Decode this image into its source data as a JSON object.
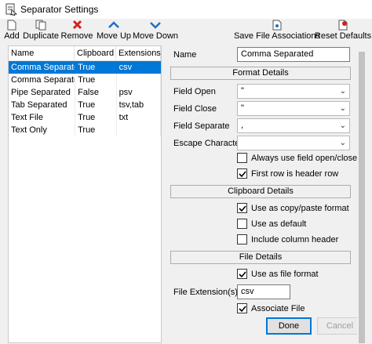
{
  "window": {
    "title": "Separator Settings"
  },
  "toolbar": {
    "add": "Add",
    "duplicate": "Duplicate",
    "remove": "Remove",
    "move_up": "Move Up",
    "move_down": "Move Down",
    "save_assoc": "Save File Associations",
    "reset": "Reset Defaults"
  },
  "list": {
    "headers": {
      "name": "Name",
      "clipboard": "Clipboard",
      "extensions": "Extensions"
    },
    "rows": [
      {
        "name": "Comma Separated",
        "clipboard": "True",
        "extensions": "csv"
      },
      {
        "name": "Comma Separated",
        "clipboard": "True",
        "extensions": ""
      },
      {
        "name": "Pipe Separated",
        "clipboard": "False",
        "extensions": "psv"
      },
      {
        "name": "Tab Separated",
        "clipboard": "True",
        "extensions": "tsv,tab"
      },
      {
        "name": "Text File",
        "clipboard": "True",
        "extensions": "txt"
      },
      {
        "name": "Text Only",
        "clipboard": "True",
        "extensions": ""
      }
    ]
  },
  "form": {
    "name_label": "Name",
    "name_value": "Comma Separated",
    "format_section": "Format Details",
    "field_open_label": "Field Open",
    "field_open_value": "\"",
    "field_close_label": "Field Close",
    "field_close_value": "\"",
    "field_sep_label": "Field Separate",
    "field_sep_value": ",",
    "escape_label": "Escape Character",
    "escape_value": "",
    "always_open_close": "Always use field open/close",
    "first_row_header": "First row is header row",
    "clipboard_section": "Clipboard Details",
    "use_copy_paste": "Use as copy/paste format",
    "use_default": "Use as default",
    "include_header": "Include column header",
    "file_section": "File Details",
    "use_file_format": "Use as file format",
    "file_ext_label": "File Extension(s)",
    "file_ext_value": "csv",
    "associate_file": "Associate File",
    "done": "Done",
    "cancel": "Cancel"
  },
  "checks": {
    "always_open_close": false,
    "first_row_header": true,
    "use_copy_paste": true,
    "use_default": false,
    "include_header": false,
    "use_file_format": true,
    "associate_file": true
  },
  "colors": {
    "selection": "#0078d7",
    "remove_red": "#d42020",
    "arrow_blue": "#1e6fc8"
  }
}
